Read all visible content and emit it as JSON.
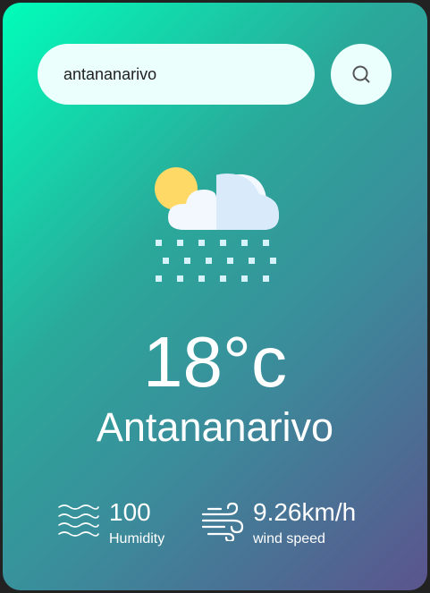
{
  "search": {
    "value": "antananarivo",
    "button_icon": "search-icon"
  },
  "weather": {
    "icon": "snow-cloud-sun-icon",
    "temperature": "18°c",
    "city": "Antananarivo"
  },
  "details": {
    "humidity": {
      "icon": "humidity-waves-icon",
      "value": "100",
      "label": "Humidity"
    },
    "wind": {
      "icon": "wind-icon",
      "value": "9.26km/h",
      "label": "wind speed"
    }
  },
  "colors": {
    "gradient_start": "#00feba",
    "gradient_end": "#5b548e",
    "input_background": "#ebfffc",
    "text": "#ffffff"
  }
}
